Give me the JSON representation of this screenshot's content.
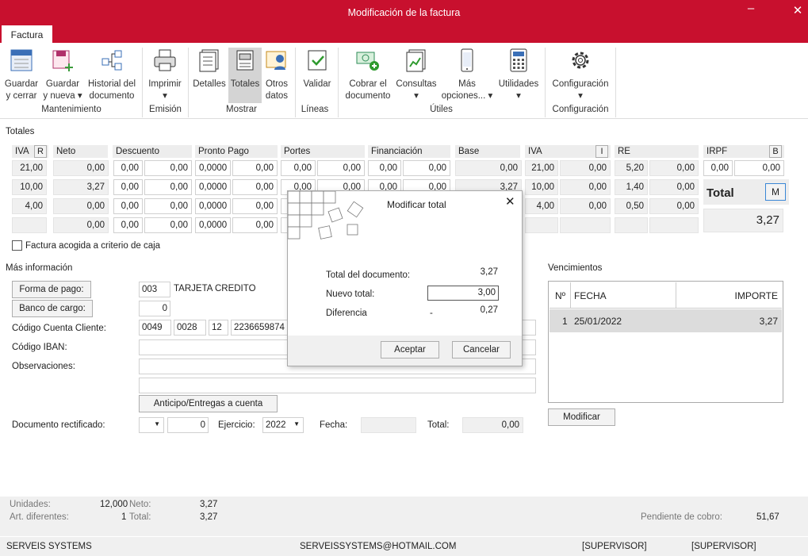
{
  "window": {
    "title": "Modificación de la factura"
  },
  "tabs": {
    "factura": "Factura"
  },
  "ribbon": {
    "guardar_cerrar": [
      "Guardar",
      "y cerrar"
    ],
    "guardar_nueva": [
      "Guardar",
      "y nueva ▾"
    ],
    "historial": [
      "Historial del",
      "documento"
    ],
    "imprimir": [
      "Imprimir",
      "▾"
    ],
    "detalles": "Detalles",
    "totales": "Totales",
    "otros": [
      "Otros",
      "datos"
    ],
    "validar": "Validar",
    "cobrar": [
      "Cobrar el",
      "documento"
    ],
    "consultas": [
      "Consultas",
      "▾"
    ],
    "mas": [
      "Más",
      "opciones... ▾"
    ],
    "utilidades": [
      "Utilidades",
      "▾"
    ],
    "configuracion": [
      "Configuración",
      "▾"
    ],
    "groups": {
      "mantenimiento": "Mantenimiento",
      "emision": "Emisión",
      "mostrar": "Mostrar",
      "lineas": "Líneas",
      "utiles": "Útiles",
      "configuracion": "Configuración"
    }
  },
  "totales": {
    "section": "Totales",
    "headers": {
      "iva": "IVA",
      "iva_btn": "R",
      "neto": "Neto",
      "descuento": "Descuento",
      "pronto": "Pronto Pago",
      "portes": "Portes",
      "financiacion": "Financiación",
      "base": "Base",
      "iva2": "IVA",
      "iva2_btn": "I",
      "re": "RE",
      "irpf": "IRPF",
      "irpf_btn": "B"
    },
    "rows": [
      {
        "iva": "21,00",
        "neto": "0,00",
        "d1": "0,00",
        "d2": "0,00",
        "p1": "0,0000",
        "p2": "0,00",
        "po1": "0,00",
        "po2": "0,00",
        "f1": "0,00",
        "f2": "0,00",
        "base": "0,00",
        "i1": "21,00",
        "i2": "0,00",
        "r1": "5,20",
        "r2": "0,00"
      },
      {
        "iva": "10,00",
        "neto": "3,27",
        "d1": "0,00",
        "d2": "0,00",
        "p1": "0,0000",
        "p2": "0,00",
        "po1": "0,00",
        "po2": "0,00",
        "f1": "0,00",
        "f2": "0,00",
        "base": "3,27",
        "i1": "10,00",
        "i2": "0,00",
        "r1": "1,40",
        "r2": "0,00"
      },
      {
        "iva": "4,00",
        "neto": "0,00",
        "d1": "0,00",
        "d2": "0,00",
        "p1": "0,0000",
        "p2": "0,00",
        "po1": "0,00",
        "po2": "0,00",
        "f1": "0,00",
        "f2": "0,00",
        "base": "0,00",
        "i1": "4,00",
        "i2": "0,00",
        "r1": "0,50",
        "r2": "0,00"
      },
      {
        "neto": "0,00",
        "d1": "0,00",
        "d2": "0,00",
        "p1": "0,0000",
        "p2": "0,00",
        "po1": "0,00",
        "po2": "0,00"
      }
    ],
    "irpf1": "0,00",
    "irpf2": "0,00",
    "total_label": "Total",
    "total_btn": "M",
    "total_value": "3,27"
  },
  "caja": "Factura acogida a criterio de caja",
  "masinfo": {
    "section": "Más información",
    "forma_pago_btn": "Forma de pago:",
    "forma_pago_code": "003",
    "forma_pago_name": "TARJETA CREDITO",
    "banco_btn": "Banco de cargo:",
    "banco_value": "0",
    "cuenta_label": "Código Cuenta Cliente:",
    "cuenta": [
      "0049",
      "0028",
      "12",
      "2236659874"
    ],
    "iban_label": "Código IBAN:",
    "obs_label": "Observaciones:",
    "anticipo_btn": "Anticipo/Entregas a cuenta",
    "doc_rect_label": "Documento rectificado:",
    "doc_rect_num": "0",
    "ejercicio_label": "Ejercicio:",
    "ejercicio_value": "2022",
    "fecha_label": "Fecha:",
    "total_label": "Total:",
    "total_value": "0,00"
  },
  "vencimientos": {
    "section": "Vencimientos",
    "headers": [
      "Nº",
      "FECHA",
      "IMPORTE"
    ],
    "rows": [
      {
        "n": "1",
        "fecha": "25/01/2022",
        "importe": "3,27"
      }
    ],
    "modificar_btn": "Modificar"
  },
  "dialog": {
    "title": "Modificar total",
    "total_doc_label": "Total del documento:",
    "total_doc_value": "3,27",
    "nuevo_label": "Nuevo total:",
    "nuevo_value": "3,00",
    "diferencia_label": "Diferencia",
    "diferencia_sign": "-",
    "diferencia_value": "0,27",
    "aceptar": "Aceptar",
    "cancelar": "Cancelar"
  },
  "status": {
    "unidades_label": "Unidades:",
    "unidades": "12,000",
    "neto_label": "Neto:",
    "neto": "3,27",
    "art_label": "Art. diferentes:",
    "art": "1",
    "total_label": "Total:",
    "total": "3,27",
    "pendiente_label": "Pendiente de cobro:",
    "pendiente": "51,67",
    "company": "SERVEIS SYSTEMS",
    "email": "SERVEISSYSTEMS@HOTMAIL.COM",
    "user1": "[SUPERVISOR]",
    "user2": "[SUPERVISOR]"
  }
}
